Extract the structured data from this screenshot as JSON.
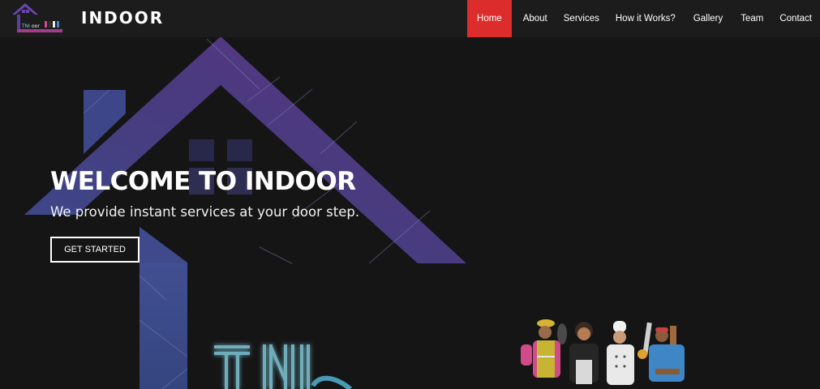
{
  "brand": {
    "name": "INDOOR",
    "logo_icon": "house-logo-icon"
  },
  "nav": {
    "items": [
      {
        "label": "Home",
        "active": true
      },
      {
        "label": "About"
      },
      {
        "label": "Services"
      },
      {
        "label": "How it Works?"
      },
      {
        "label": "Gallery"
      },
      {
        "label": "Team"
      },
      {
        "label": "Contact"
      }
    ],
    "active_color": "#dd2c2c"
  },
  "hero": {
    "title": "WELCOME TO INDOOR",
    "subtitle": "We provide instant services at your door step.",
    "cta_label": "GET STARTED",
    "background_art": "house-outline-illustration",
    "workers_art": "service-workers-illustration",
    "accent_colors": [
      "#5a3a86",
      "#3e4d8f",
      "#6fb6c8"
    ]
  }
}
